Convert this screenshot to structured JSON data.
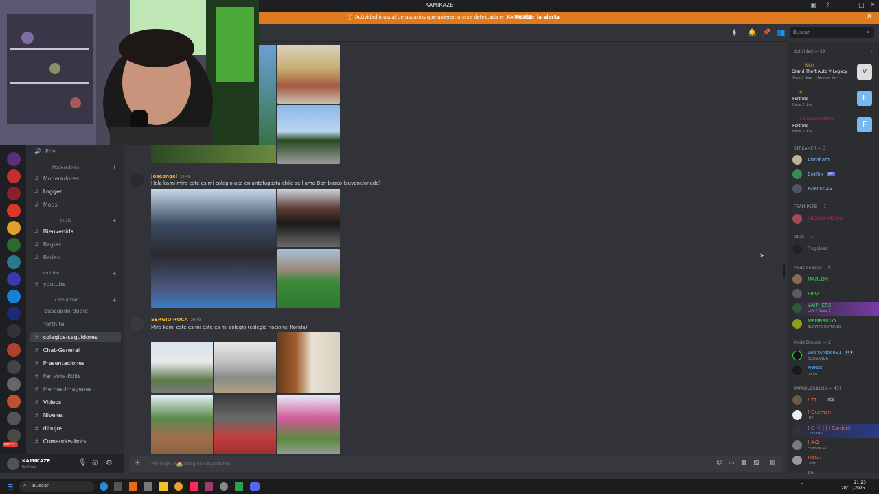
{
  "window": {
    "title": "KAMIKAZE"
  },
  "alert": {
    "message": "Actividad inusual de usuarios que quieren unirse detectada en KAMIKAZE",
    "link": "Revisar la alerta"
  },
  "search": {
    "placeholder": "Buscar"
  },
  "sidebar": {
    "categories": {
      "moderadores": "Moderadores",
      "inicio": "Inicio",
      "youtube": "Youtube",
      "comunidad": "Comunidad"
    },
    "channels": {
      "priv": "Priv.",
      "moderadores": "Moderadores",
      "logger": "Logger",
      "mods": "Mods",
      "bienvenida": "Bienvenida",
      "reglas": "Reglas",
      "redes": "Redes",
      "youtube": "youtube",
      "buscando": "buscando-doble",
      "fortnite": "fortnite",
      "colegios": "colegios-seguidores",
      "chat": "Chat-General",
      "presentaciones": "Presentaciones",
      "fanarts": "Fan-Arts-Edits",
      "memes": "Memes-Imagenes",
      "videos": "Videos",
      "niveles": "Niveles",
      "dibujos": "dibujos",
      "bots": "Comandos-bots"
    },
    "badge_new": "NUEVO"
  },
  "user": {
    "name": "KAMIKAZE",
    "status": "En línea"
  },
  "messages": [
    {
      "author": "Joseangel",
      "time": "20:49",
      "text": "Hola kami mira este es mi colegio aca en antofagasta chile se llama Don bosco (suvencionado)"
    },
    {
      "author": "SERGIO ROCA",
      "time": "20:49",
      "text": "Mira kami este es mi este es mi colegio (colegio nacional florida)"
    }
  ],
  "composer": {
    "placeholder": "Mensaje #🏫colegios-seguidores"
  },
  "members": {
    "activity": {
      "header": "Actividad — 39",
      "items": [
        {
          "name": "Rich",
          "game": "Grand Theft Auto V Legacy",
          "meta": "Hace 2 días • Maratón de 4 ..."
        },
        {
          "name": "A...",
          "game": "Fortnite",
          "meta": "Hace 2 días"
        },
        {
          "name": "! BOLSONARO0O",
          "game": "Fortnite",
          "meta": "Hace 3 días"
        }
      ]
    },
    "groups": [
      {
        "header": "STREAMER — 3",
        "items": [
          {
            "name": "Abraham",
            "sub": "",
            "tag": "",
            "color": "#7fb8ff"
          },
          {
            "name": "BotRix",
            "sub": "",
            "tag": "APP",
            "color": "#7fb8ff"
          },
          {
            "name": "KAMIKAZE",
            "sub": "",
            "tag": "",
            "color": "#7fb8ff"
          }
        ]
      },
      {
        "header": "TEAM PETE — 1",
        "items": [
          {
            "name": "! BOLSONARO0O",
            "sub": "",
            "tag": "",
            "color": "#e8175d"
          }
        ]
      },
      {
        "header": "DIOS — 1",
        "items": [
          {
            "name": "Fregoleez",
            "sub": "",
            "tag": "",
            "color": "#8a8d94"
          }
        ]
      },
      {
        "header": "Mods de Kick — 4",
        "items": [
          {
            "name": "MARLON",
            "sub": "",
            "tag": "",
            "color": "#3ed44e"
          },
          {
            "name": "PIPO",
            "sub": "",
            "tag": "",
            "color": "#3ed44e"
          },
          {
            "name": "VAIPHERS",
            "sub": "Left 4 Dead 2",
            "tag": "",
            "color": "#3ed44e"
          },
          {
            "name": "MEMBRILLO",
            "sub": "BURRITO ENTERNO",
            "tag": "",
            "color": "#3ed44e"
          }
        ]
      },
      {
        "header": "Mods Discord — 2",
        "items": [
          {
            "name": "Leonardoco91",
            "sub": "BOLIGANGA",
            "tag": "KICK",
            "color": "#5ab0ff"
          },
          {
            "name": "Nexus",
            "sub": "Invite",
            "tag": "",
            "color": "#5ab0ff"
          }
        ]
      },
      {
        "header": "KAMIQUESILLOS — 451",
        "items": [
          {
            "name": "! T1",
            "sub": "",
            "tag": "FCB",
            "color": "#e86a3a"
          },
          {
            "name": "! Guzmán",
            "sub": "IDK",
            "tag": "",
            "color": "#e86a3a"
          },
          {
            "name": "! Ω ⓞ | | i Cardael",
            "sub": "LETTERS",
            "tag": "",
            "color": "#e86a3a"
          },
          {
            "name": "! ✈Ω",
            "sub": "Fortnite +1",
            "tag": "",
            "color": "#e86a3a"
          },
          {
            "name": "!TaGu",
            "sub": "Goat",
            "tag": "",
            "color": "#e86a3a"
          },
          {
            "name": "66",
            "sub": "",
            "tag": "",
            "color": "#e86a3a"
          }
        ]
      }
    ]
  },
  "taskbar": {
    "search": "Buscar",
    "time": "21:23",
    "date": "20/11/2025"
  }
}
